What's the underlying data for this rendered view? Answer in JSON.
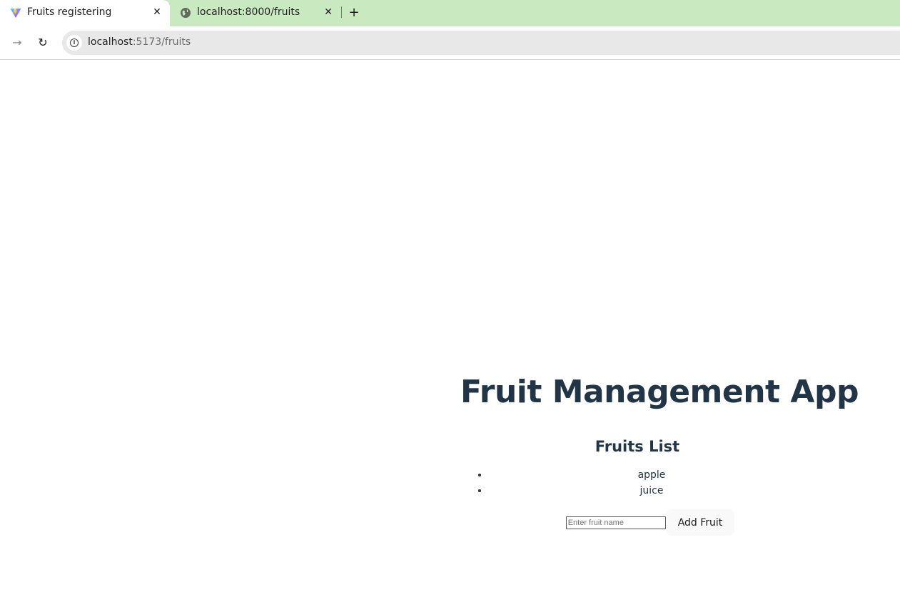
{
  "browser": {
    "tabs": [
      {
        "title": "Fruits registering",
        "favicon": "vite-logo-icon",
        "active": true
      },
      {
        "title": "localhost:8000/fruits",
        "favicon": "globe-icon",
        "active": false
      }
    ],
    "close_glyph": "✕",
    "new_tab_glyph": "+",
    "forward_glyph": "→",
    "reload_glyph": "↻",
    "address": {
      "host": "localhost",
      "path": ":5173/fruits"
    }
  },
  "app": {
    "title": "Fruit Management App",
    "list_title": "Fruits List",
    "fruits": [
      "apple",
      "juice"
    ],
    "input_placeholder": "Enter fruit name",
    "input_value": "",
    "add_button_label": "Add Fruit"
  },
  "colors": {
    "tabstrip_bg": "#c9eac0",
    "text_heading": "#213547",
    "button_bg": "#f9f9f9"
  }
}
